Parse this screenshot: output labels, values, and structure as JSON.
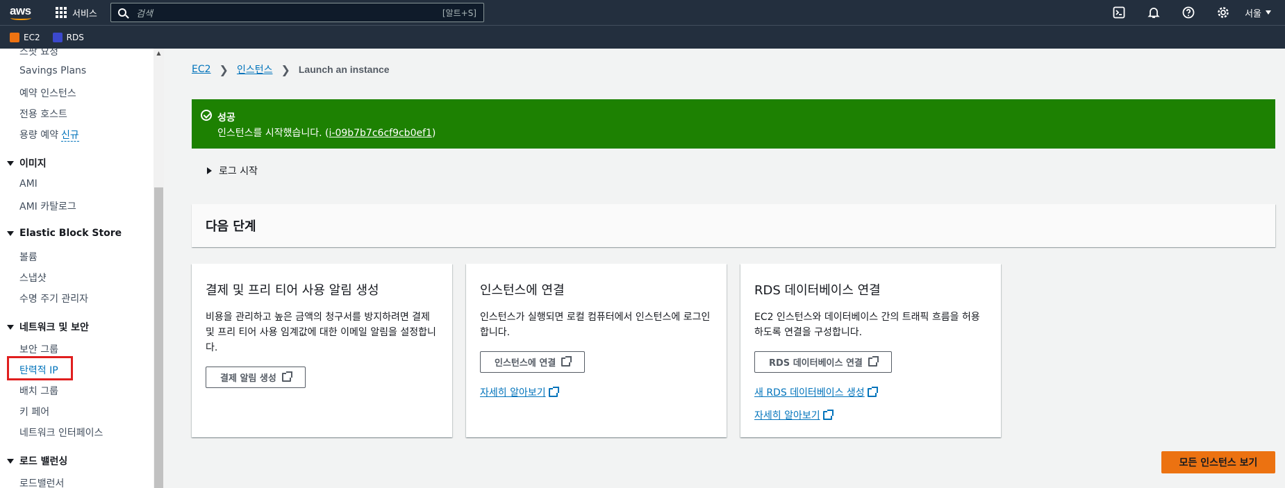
{
  "topbar": {
    "logo": "aws",
    "services_label": "서비스",
    "search_placeholder": "검색",
    "search_shortcut": "[알트+S]",
    "region": "서울"
  },
  "favorites": [
    {
      "label": "EC2",
      "color": "#ec7211"
    },
    {
      "label": "RDS",
      "color": "#3b48cc"
    }
  ],
  "sidebar": {
    "partial_top": "스팟 요청",
    "items_top": [
      "Savings Plans",
      "예약 인스턴스",
      "전용 호스트",
      "용량 예약"
    ],
    "new_badge": "신규",
    "sections": [
      {
        "title": "이미지",
        "items": [
          "AMI",
          "AMI 카탈로그"
        ]
      },
      {
        "title": "Elastic Block Store",
        "items": [
          "볼륨",
          "스냅샷",
          "수명 주기 관리자"
        ]
      },
      {
        "title": "네트워크 및 보안",
        "items": [
          "보안 그룹",
          "탄력적 IP",
          "배치 그룹",
          "키 페어",
          "네트워크 인터페이스"
        ]
      },
      {
        "title": "로드 밸런싱",
        "items": [
          "로드밸런서"
        ]
      }
    ]
  },
  "breadcrumb": {
    "items": [
      "EC2",
      "인스턴스"
    ],
    "current": "Launch an instance"
  },
  "flash": {
    "title": "성공",
    "message": "인스턴스를 시작했습니다. (",
    "instance_id": "i-09b7b7c6cf9cb0ef1",
    "message_end": ")"
  },
  "log": {
    "label": "로그 시작"
  },
  "next_steps": {
    "title": "다음 단계"
  },
  "cards": [
    {
      "title": "결제 및 프리 티어 사용 알림 생성",
      "body": "비용을 관리하고 높은 금액의 청구서를 방지하려면 결제 및 프리 티어 사용 임계값에 대한 이메일 알림을 설정합니다.",
      "button": "결제 알림 생성"
    },
    {
      "title": "인스턴스에 연결",
      "body": "인스턴스가 실행되면 로컬 컴퓨터에서 인스턴스에 로그인합니다.",
      "button": "인스턴스에 연결",
      "link": "자세히 알아보기"
    },
    {
      "title": "RDS 데이터베이스 연결",
      "body": "EC2 인스턴스와 데이터베이스 간의 트래픽 흐름을 허용하도록 연결을 구성합니다.",
      "button": "RDS 데이터베이스 연결",
      "link": "새 RDS 데이터베이스 생성",
      "link2": "자세히 알아보기"
    }
  ],
  "primary_button": "모든 인스턴스 보기"
}
